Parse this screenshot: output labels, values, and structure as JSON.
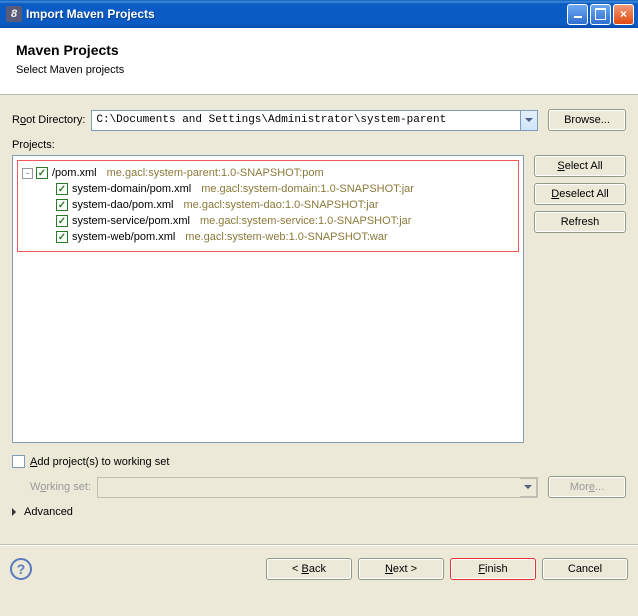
{
  "window": {
    "title": "Import Maven Projects"
  },
  "header": {
    "title": "Maven Projects",
    "subtitle": "Select Maven projects"
  },
  "rootDir": {
    "label_pre": "R",
    "label_ul": "o",
    "label_post": "ot Directory:",
    "value": "C:\\Documents and Settings\\Administrator\\system-parent",
    "browse_label": "Browse..."
  },
  "projectsLabel": "Projects:",
  "buttons": {
    "selectAll_pre": "",
    "selectAll_ul": "S",
    "selectAll_post": "elect All",
    "deselectAll_pre": "",
    "deselectAll_ul": "D",
    "deselectAll_post": "eselect All",
    "refresh": "Refresh"
  },
  "tree": [
    {
      "name": "/pom.xml",
      "desc": "me.gacl:system-parent:1.0-SNAPSHOT:pom",
      "level": 0,
      "expander": "-"
    },
    {
      "name": "system-domain/pom.xml",
      "desc": "me.gacl:system-domain:1.0-SNAPSHOT:jar",
      "level": 1,
      "expander": ""
    },
    {
      "name": "system-dao/pom.xml",
      "desc": "me.gacl:system-dao:1.0-SNAPSHOT:jar",
      "level": 1,
      "expander": ""
    },
    {
      "name": "system-service/pom.xml",
      "desc": "me.gacl:system-service:1.0-SNAPSHOT:jar",
      "level": 1,
      "expander": ""
    },
    {
      "name": "system-web/pom.xml",
      "desc": "me.gacl:system-web:1.0-SNAPSHOT:war",
      "level": 1,
      "expander": ""
    }
  ],
  "workingSet": {
    "check_pre": "",
    "check_ul": "A",
    "check_post": "dd project(s) to working set",
    "label_pre": "W",
    "label_ul": "o",
    "label_post": "rking set:",
    "more_pre": "Mor",
    "more_ul": "e",
    "more_post": "..."
  },
  "advanced": {
    "label": "Advanced"
  },
  "footer": {
    "back_pre": "< ",
    "back_ul": "B",
    "back_post": "ack",
    "next_pre": "",
    "next_ul": "N",
    "next_post": "ext >",
    "finish_pre": "",
    "finish_ul": "F",
    "finish_post": "inish",
    "cancel": "Cancel"
  },
  "watermark": ""
}
